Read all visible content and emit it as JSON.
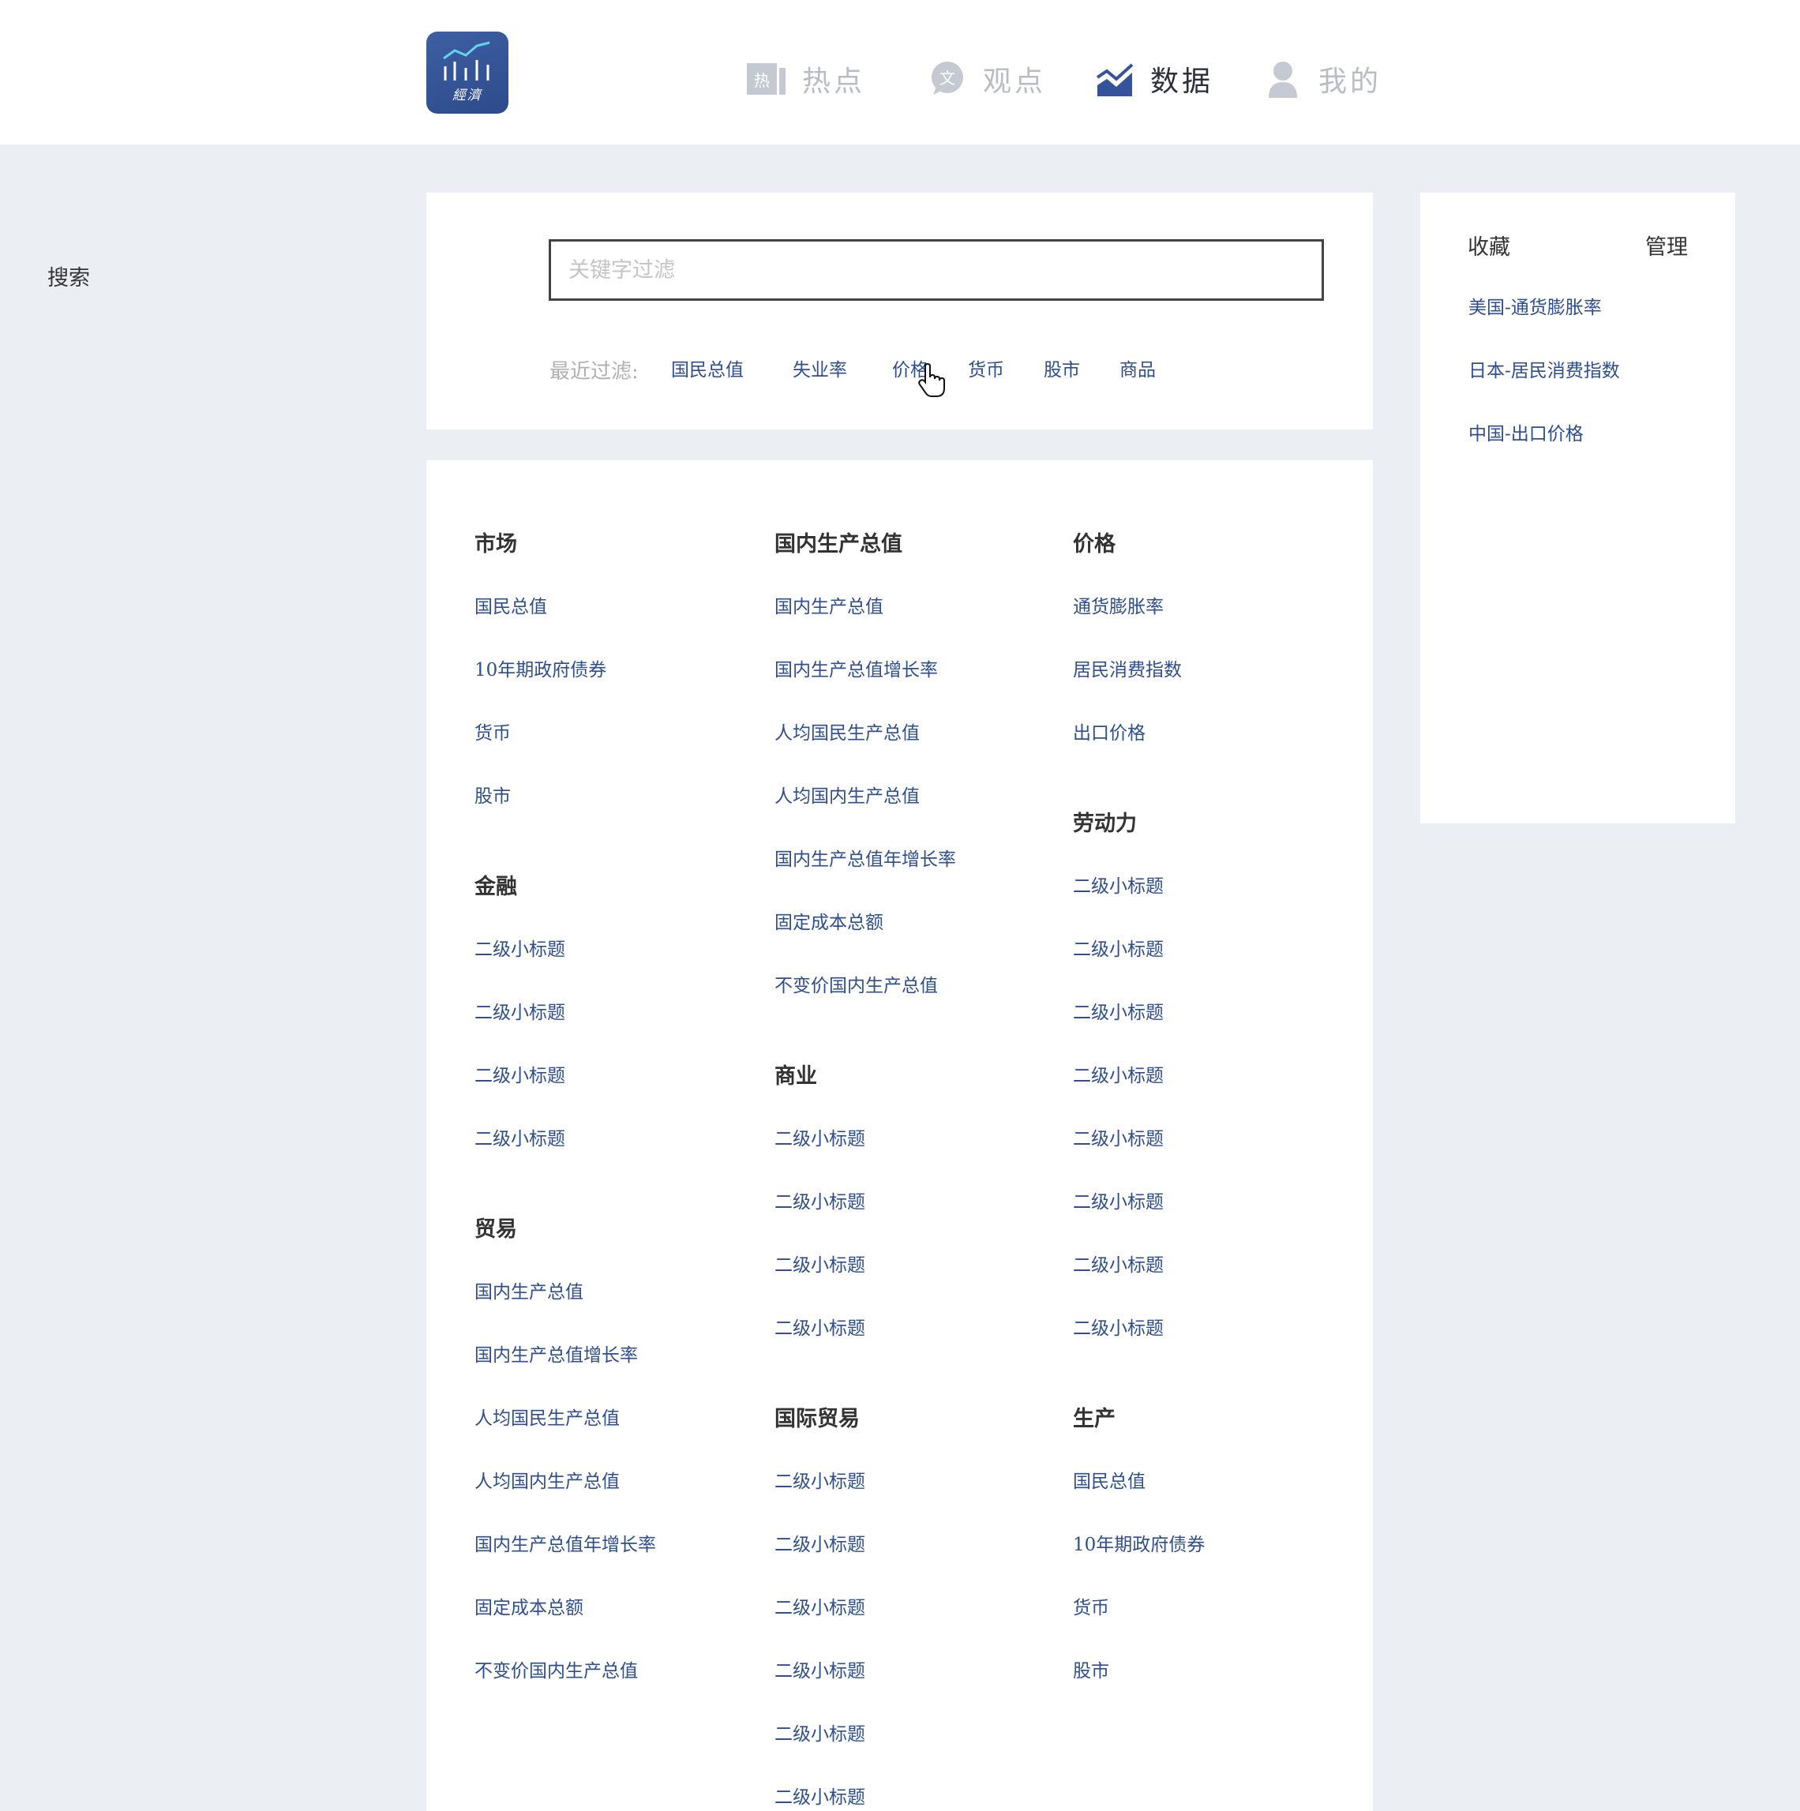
{
  "header": {
    "logo_text": "經濟",
    "nav": [
      {
        "label": "热点",
        "icon": "hot-icon",
        "active": false
      },
      {
        "label": "观点",
        "icon": "view-icon",
        "active": false
      },
      {
        "label": "数据",
        "icon": "chart-icon",
        "active": true
      },
      {
        "label": "我的",
        "icon": "user-icon",
        "active": false
      }
    ],
    "hot_icon_glyph": "热",
    "view_icon_glyph": "文"
  },
  "search": {
    "label": "搜索",
    "placeholder": "关键字过滤",
    "value": "",
    "recent_label": "最近过滤:",
    "recent": [
      "国民总值",
      "失业率",
      "价格",
      "货币",
      "股市",
      "商品"
    ]
  },
  "favorites": {
    "title": "收藏",
    "manage": "管理",
    "items": [
      "美国-通货膨胀率",
      "日本-居民消费指数",
      "中国-出口价格"
    ]
  },
  "categories": {
    "col1": [
      {
        "heading": "市场",
        "items": [
          "国民总值",
          "10年期政府债券",
          "货币",
          "股市"
        ]
      },
      {
        "heading": "金融",
        "items": [
          "二级小标题",
          "二级小标题",
          "二级小标题",
          "二级小标题"
        ]
      },
      {
        "heading": "贸易",
        "items": [
          "国内生产总值",
          "国内生产总值增长率",
          "人均国民生产总值",
          "人均国内生产总值",
          "国内生产总值年增长率",
          "固定成本总额",
          "不变价国内生产总值"
        ]
      }
    ],
    "col2": [
      {
        "heading": "国内生产总值",
        "items": [
          "国内生产总值",
          "国内生产总值增长率",
          "人均国民生产总值",
          "人均国内生产总值",
          "国内生产总值年增长率",
          "固定成本总额",
          "不变价国内生产总值"
        ]
      },
      {
        "heading": "商业",
        "items": [
          "二级小标题",
          "二级小标题",
          "二级小标题",
          "二级小标题"
        ]
      },
      {
        "heading": "国际贸易",
        "items": [
          "二级小标题",
          "二级小标题",
          "二级小标题",
          "二级小标题",
          "二级小标题",
          "二级小标题"
        ]
      }
    ],
    "col3": [
      {
        "heading": "价格",
        "items": [
          "通货膨胀率",
          "居民消费指数",
          "出口价格"
        ]
      },
      {
        "heading": "劳动力",
        "items": [
          "二级小标题",
          "二级小标题",
          "二级小标题",
          "二级小标题",
          "二级小标题",
          "二级小标题",
          "二级小标题",
          "二级小标题"
        ]
      },
      {
        "heading": "生产",
        "items": [
          "国民总值",
          "10年期政府债券",
          "货币",
          "股市"
        ]
      }
    ]
  },
  "colors": {
    "link": "#2e4e8e",
    "brand": "#34539a",
    "background": "#ebeef2",
    "nav_inactive": "#b8bcc6"
  }
}
